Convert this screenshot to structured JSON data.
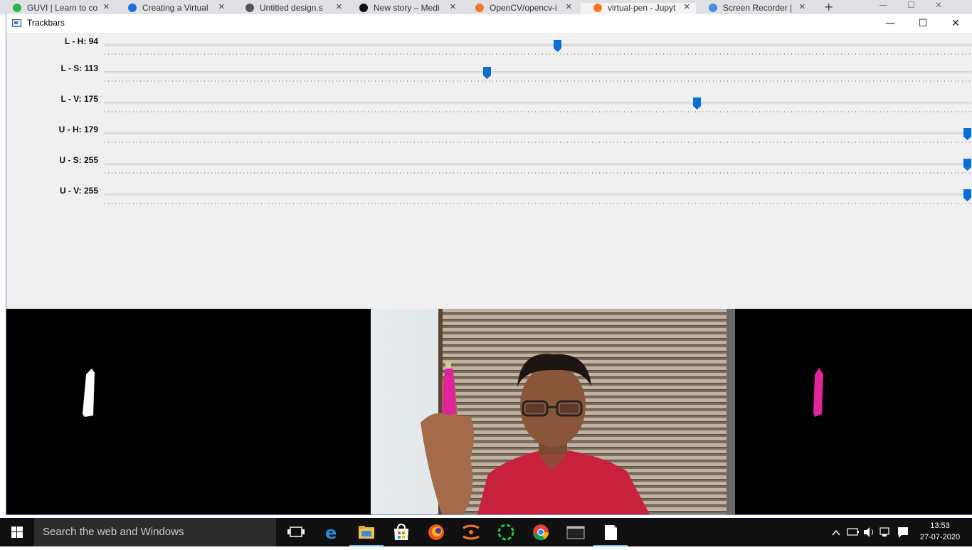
{
  "browser": {
    "tabs": [
      {
        "title": "GUVI | Learn to co",
        "favicon_color": "#2db34a"
      },
      {
        "title": "Creating a Virtual",
        "favicon_color": "#1d6fd6"
      },
      {
        "title": "Untitled design.s",
        "favicon_color": "#555555"
      },
      {
        "title": "New story – Medi",
        "favicon_color": "#111111"
      },
      {
        "title": "OpenCV/opencv-i",
        "favicon_color": "#f37626"
      },
      {
        "title": "virtual-pen - Jupyt",
        "favicon_color": "#f37626"
      },
      {
        "title": "Screen Recorder |",
        "favicon_color": "#4a90d9"
      }
    ],
    "new_tab_glyph": "+"
  },
  "window": {
    "title": "Trackbars",
    "minimize_glyph": "—",
    "maximize_glyph": "☐",
    "close_glyph": "✕"
  },
  "trackbars": [
    {
      "label": "L - H: 94",
      "name": "L - H",
      "value": 94,
      "max": 179
    },
    {
      "label": "L - S: 113",
      "name": "L - S",
      "value": 113,
      "max": 255
    },
    {
      "label": "L - V: 175",
      "name": "L - V",
      "value": 175,
      "max": 255
    },
    {
      "label": "U - H: 179",
      "name": "U - H",
      "value": 179,
      "max": 179
    },
    {
      "label": "U - S: 255",
      "name": "U - S",
      "value": 255,
      "max": 255
    },
    {
      "label": "U - V: 255",
      "name": "U - V",
      "value": 255,
      "max": 255
    }
  ],
  "colors": {
    "thumb": "#0a6fd4",
    "pen_magenta": "#e0249a",
    "shirt_red": "#c8213b"
  },
  "taskbar": {
    "search_placeholder": "Search the web and Windows",
    "apps": [
      "task-view",
      "edge",
      "file-explorer",
      "store",
      "firefox",
      "jupyter",
      "recorder",
      "chrome",
      "terminal",
      "notepad"
    ],
    "time": "13:53",
    "date": "27-07-2020"
  }
}
